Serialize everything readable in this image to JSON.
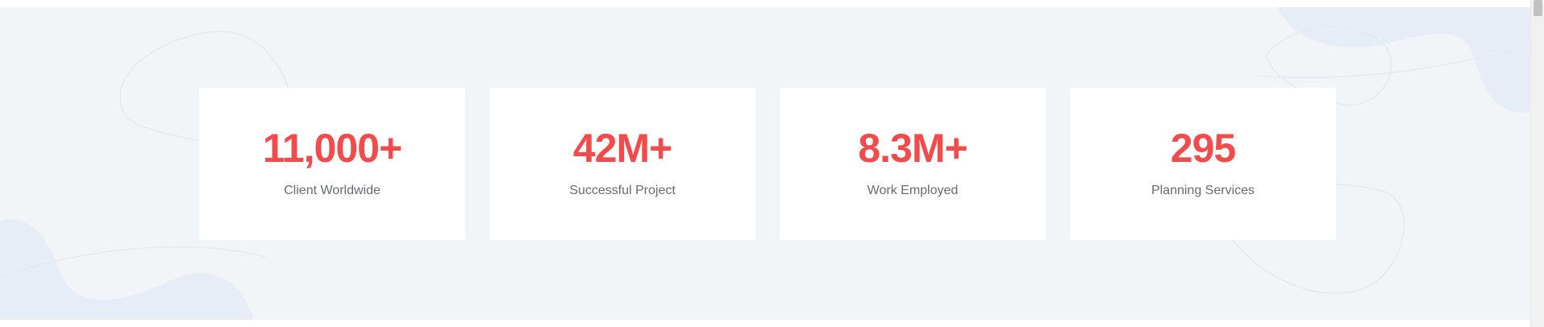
{
  "colors": {
    "accent": "#f24b4b",
    "label": "#666a72",
    "section_bg": "#f2f5f8",
    "card_bg": "#ffffff"
  },
  "stats": [
    {
      "value": "11,000+",
      "label": "Client Worldwide"
    },
    {
      "value": "42M+",
      "label": "Successful Project"
    },
    {
      "value": "8.3M+",
      "label": "Work Employed"
    },
    {
      "value": "295",
      "label": "Planning Services"
    }
  ]
}
